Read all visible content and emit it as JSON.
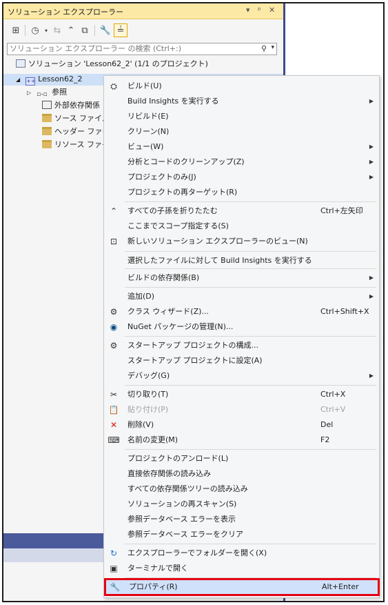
{
  "panel": {
    "title": "ソリューション エクスプローラー",
    "title_controls": [
      "▾",
      "ᵖ",
      "✕"
    ],
    "search_placeholder": "ソリューション エクスプローラー の検索 (Ctrl+:)"
  },
  "tree": {
    "solution": "ソリューション 'Lesson62_2' (1/1 のプロジェクト)",
    "project": "Lesson62_2",
    "project_icon_text": "++",
    "references": "参照",
    "references_icon_text": "▫-▫",
    "external_deps": "外部依存関係",
    "source_files": "ソース ファイル",
    "header_files": "ヘッダー ファイル",
    "resource_files": "リソース ファイル"
  },
  "menu": {
    "items": [
      {
        "icon": "build-icon",
        "label": "ビルド(U)",
        "shortcut": "",
        "submenu": false
      },
      {
        "icon": "",
        "label": "Build Insights を実行する",
        "shortcut": "",
        "submenu": true
      },
      {
        "icon": "",
        "label": "リビルド(E)",
        "shortcut": "",
        "submenu": false
      },
      {
        "icon": "",
        "label": "クリーン(N)",
        "shortcut": "",
        "submenu": false
      },
      {
        "icon": "",
        "label": "ビュー(W)",
        "shortcut": "",
        "submenu": true
      },
      {
        "icon": "",
        "label": "分析とコードのクリーンアップ(Z)",
        "shortcut": "",
        "submenu": true
      },
      {
        "icon": "",
        "label": "プロジェクトのみ(J)",
        "shortcut": "",
        "submenu": true
      },
      {
        "icon": "",
        "label": "プロジェクトの再ターゲット(R)",
        "shortcut": "",
        "submenu": false
      },
      {
        "icon": "collapse-icon",
        "label": "すべての子孫を折りたたむ",
        "shortcut": "Ctrl+左矢印",
        "submenu": false
      },
      {
        "icon": "",
        "label": "ここまでスコープ指定する(S)",
        "shortcut": "",
        "submenu": false
      },
      {
        "icon": "new-view-icon",
        "label": "新しいソリューション エクスプローラーのビュー(N)",
        "shortcut": "",
        "submenu": false
      },
      {
        "icon": "",
        "label": "選択したファイルに対して Build Insights を実行する",
        "shortcut": "",
        "submenu": false
      },
      {
        "icon": "",
        "label": "ビルドの依存関係(B)",
        "shortcut": "",
        "submenu": true
      },
      {
        "icon": "",
        "label": "追加(D)",
        "shortcut": "",
        "submenu": true
      },
      {
        "icon": "class-wizard-icon",
        "label": "クラス ウィザード(Z)...",
        "shortcut": "Ctrl+Shift+X",
        "submenu": false
      },
      {
        "icon": "nuget-icon",
        "label": "NuGet パッケージの管理(N)...",
        "shortcut": "",
        "submenu": false
      },
      {
        "icon": "gear-icon",
        "label": "スタートアップ プロジェクトの構成...",
        "shortcut": "",
        "submenu": false
      },
      {
        "icon": "",
        "label": "スタートアップ プロジェクトに設定(A)",
        "shortcut": "",
        "submenu": false
      },
      {
        "icon": "",
        "label": "デバッグ(G)",
        "shortcut": "",
        "submenu": true
      },
      {
        "icon": "scissors-icon",
        "label": "切り取り(T)",
        "shortcut": "Ctrl+X",
        "submenu": false
      },
      {
        "icon": "paste-icon",
        "label": "貼り付け(P)",
        "shortcut": "Ctrl+V",
        "submenu": false,
        "disabled": true
      },
      {
        "icon": "delete-icon",
        "label": "削除(V)",
        "shortcut": "Del",
        "submenu": false
      },
      {
        "icon": "rename-icon",
        "label": "名前の変更(M)",
        "shortcut": "F2",
        "submenu": false
      },
      {
        "icon": "",
        "label": "プロジェクトのアンロード(L)",
        "shortcut": "",
        "submenu": false
      },
      {
        "icon": "",
        "label": "直接依存関係の読み込み",
        "shortcut": "",
        "submenu": false
      },
      {
        "icon": "",
        "label": "すべての依存関係ツリーの読み込み",
        "shortcut": "",
        "submenu": false
      },
      {
        "icon": "",
        "label": "ソリューションの再スキャン(S)",
        "shortcut": "",
        "submenu": false
      },
      {
        "icon": "",
        "label": "参照データベース エラーを表示",
        "shortcut": "",
        "submenu": false
      },
      {
        "icon": "",
        "label": "参照データベース エラーをクリア",
        "shortcut": "",
        "submenu": false
      },
      {
        "icon": "open-folder-icon",
        "label": "エクスプローラーでフォルダーを開く(X)",
        "shortcut": "",
        "submenu": false
      },
      {
        "icon": "terminal-icon",
        "label": "ターミナルで開く",
        "shortcut": "",
        "submenu": false
      },
      {
        "icon": "wrench-icon",
        "label": "プロパティ(R)",
        "shortcut": "Alt+Enter",
        "submenu": false,
        "highlighted": true
      }
    ]
  },
  "colors": {
    "title_bar": "#fce9a6",
    "highlight_box": "#e60012",
    "selected_row": "#cde0f7"
  }
}
